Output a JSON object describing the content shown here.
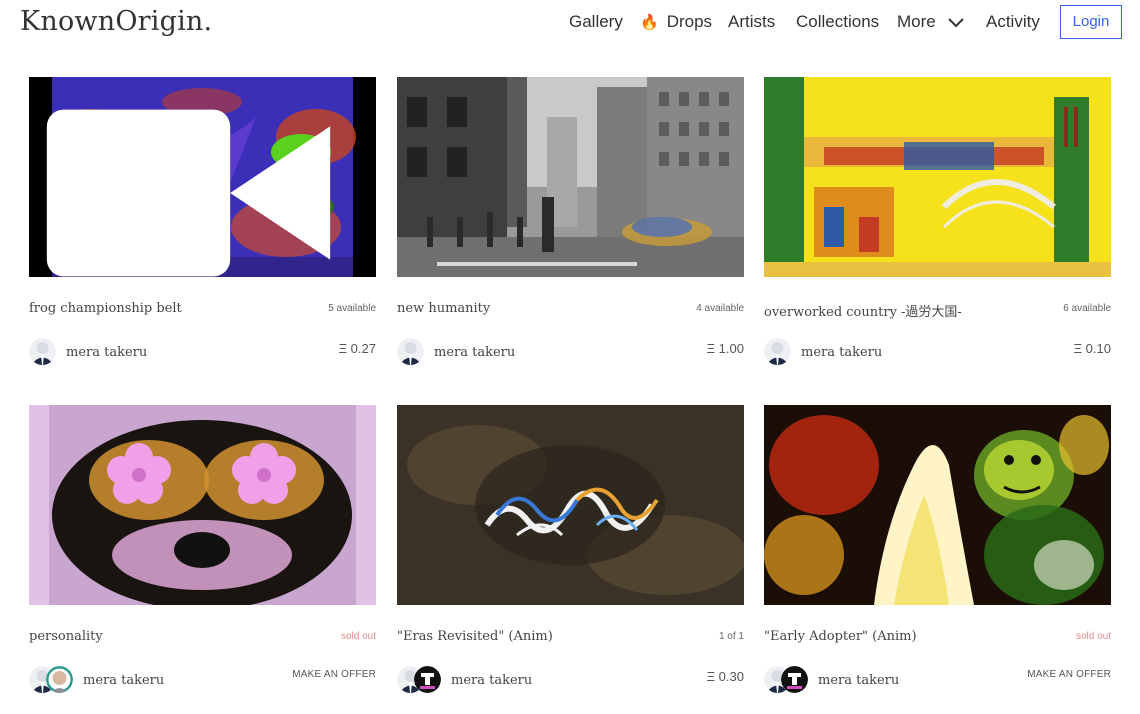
{
  "header": {
    "logo": "KnownOrigin",
    "logo_dot": ".",
    "nav": {
      "gallery": "Gallery",
      "drops_icon": "🔥",
      "drops": "Drops",
      "artists": "Artists",
      "collections": "Collections",
      "more": "More",
      "activity": "Activity",
      "login": "Login"
    }
  },
  "cards": [
    {
      "title": "frog championship belt",
      "availability": "5 available",
      "artist": "mera takeru",
      "price": "Ξ 0.27",
      "media_icon": "video-camera-icon"
    },
    {
      "title": "new humanity",
      "availability": "4 available",
      "artist": "mera takeru",
      "price": "Ξ 1.00"
    },
    {
      "title": "overworked country -過労大国-",
      "availability": "6 available",
      "artist": "mera takeru",
      "price": "Ξ 0.10"
    },
    {
      "title": "personality",
      "availability": "sold out",
      "artist": "mera takeru",
      "price": "MAKE AN OFFER"
    },
    {
      "title": "\"Eras Revisited\" (Anim)",
      "availability": "1 of 1",
      "artist": "mera takeru",
      "price": "Ξ 0.30"
    },
    {
      "title": "\"Early Adopter\" (Anim)",
      "availability": "sold out",
      "artist": "mera takeru",
      "price": "MAKE AN OFFER"
    }
  ],
  "colors": {
    "accent": "#3b5ee5",
    "sold_out": "#e68a8a"
  }
}
